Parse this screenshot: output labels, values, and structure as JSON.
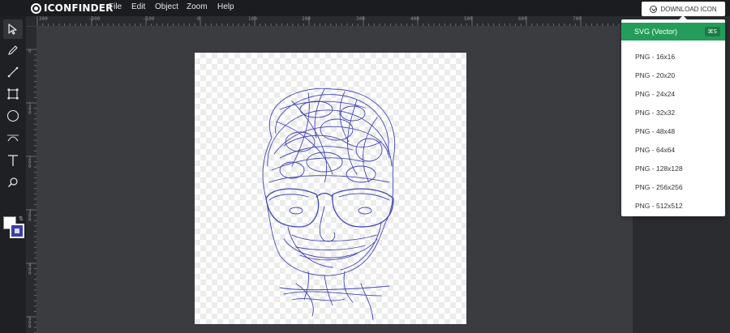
{
  "app": {
    "name": "ICONFINDER"
  },
  "menu": [
    "File",
    "Edit",
    "Object",
    "Zoom",
    "Help"
  ],
  "download_button": {
    "label": "DOWNLOAD ICON",
    "icon": "download-circle-icon"
  },
  "tools": [
    {
      "name": "select-tool",
      "icon": "arrow-pointer-icon",
      "active": true
    },
    {
      "name": "pencil-tool",
      "icon": "pencil-icon"
    },
    {
      "name": "line-tool",
      "icon": "line-icon"
    },
    {
      "name": "rectangle-tool",
      "icon": "rectangle-icon"
    },
    {
      "name": "ellipse-tool",
      "icon": "circle-icon"
    },
    {
      "name": "path-tool",
      "icon": "bezier-icon"
    },
    {
      "name": "text-tool",
      "icon": "text-icon"
    },
    {
      "name": "zoom-tool",
      "icon": "magnifier-icon"
    }
  ],
  "colors": {
    "fill": "#ffffff",
    "stroke": "#3a3fa8",
    "accent": "#259d5a",
    "sketch": "#4146b4"
  },
  "ruler": {
    "top_labels": [
      "300",
      "-200",
      "-100",
      "0",
      "100",
      "200",
      "300",
      "400",
      "500",
      "600",
      "700"
    ],
    "left_labels": [
      "0",
      "1 0 0",
      "2 0 0",
      "3 0 0",
      "4 0 0",
      "5 0 0"
    ]
  },
  "download_menu": {
    "primary": {
      "label": "SVG (Vector)",
      "shortcut": "⌘S"
    },
    "items": [
      "PNG - 16x16",
      "PNG - 20x20",
      "PNG - 24x24",
      "PNG - 32x32",
      "PNG - 48x48",
      "PNG - 64x64",
      "PNG - 128x128",
      "PNG - 256x256",
      "PNG - 512x512"
    ]
  }
}
